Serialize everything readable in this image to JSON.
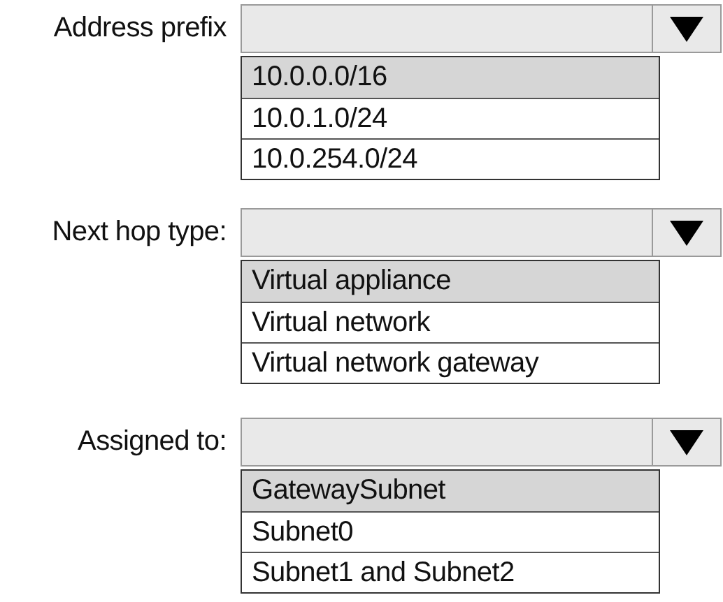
{
  "dropdowns": [
    {
      "label": "Address prefix",
      "options": [
        {
          "text": "10.0.0.0/16",
          "selected": true
        },
        {
          "text": "10.0.1.0/24",
          "selected": false
        },
        {
          "text": "10.0.254.0/24",
          "selected": false
        }
      ]
    },
    {
      "label": "Next hop type:",
      "options": [
        {
          "text": "Virtual appliance",
          "selected": true
        },
        {
          "text": "Virtual network",
          "selected": false
        },
        {
          "text": "Virtual network gateway",
          "selected": false
        }
      ]
    },
    {
      "label": "Assigned to:",
      "options": [
        {
          "text": "GatewaySubnet",
          "selected": true
        },
        {
          "text": "Subnet0",
          "selected": false
        },
        {
          "text": "Subnet1 and Subnet2",
          "selected": false
        }
      ]
    }
  ]
}
